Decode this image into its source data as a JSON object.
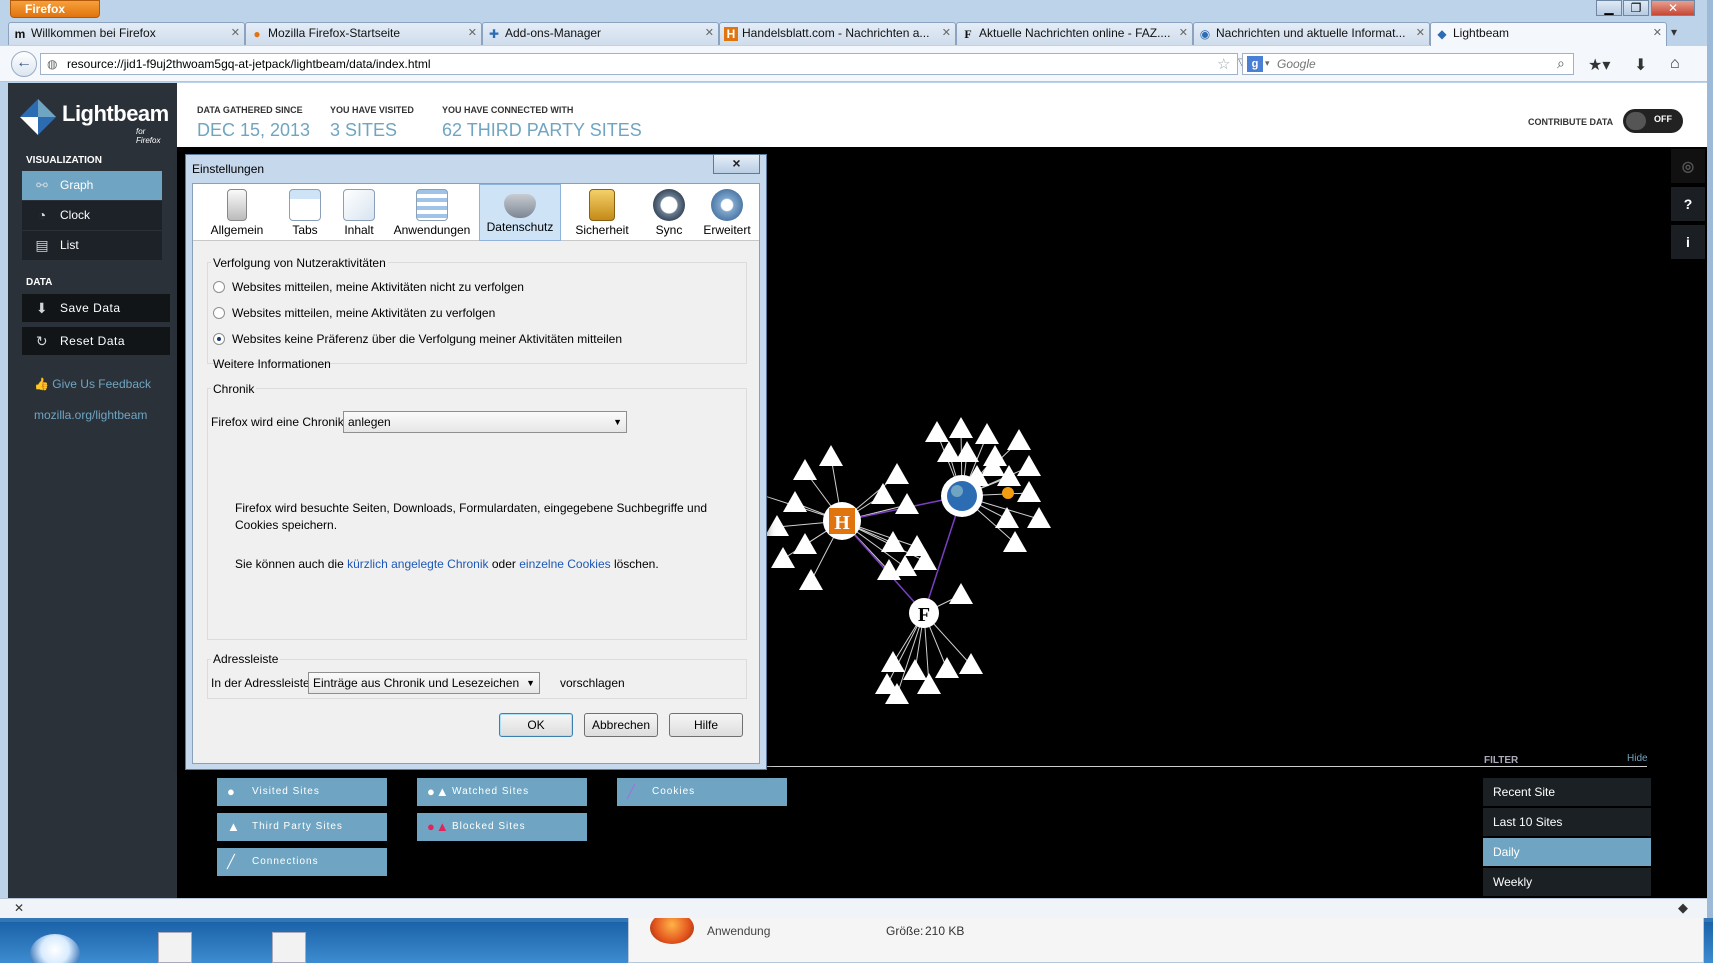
{
  "colors": {
    "accent": "#6fa5c2",
    "sidebar": "#2a3139",
    "firefox_orange": "#e0740f"
  },
  "firefox": {
    "menu_button": "Firefox",
    "tabs": [
      {
        "icon": "m",
        "label": "Willkommen bei Firefox"
      },
      {
        "icon": "ff",
        "label": "Mozilla Firefox-Startseite"
      },
      {
        "icon": "puzzle",
        "label": "Add-ons-Manager"
      },
      {
        "icon": "H",
        "label": "Handelsblatt.com - Nachrichten a..."
      },
      {
        "icon": "F",
        "label": "Aktuelle Nachrichten online - FAZ...."
      },
      {
        "icon": "e",
        "label": "Nachrichten und aktuelle Informat..."
      },
      {
        "icon": "lb",
        "label": "Lightbeam"
      }
    ],
    "url": "resource://jid1-f9uj2thwoam5gq-at-jetpack/lightbeam/data/index.html",
    "search_placeholder": "Google",
    "search_engine_letter": "g"
  },
  "lightbeam": {
    "logo_text": "Lightbeam",
    "logo_sub": "for Firefox",
    "visualization_header": "VISUALIZATION",
    "nav": [
      {
        "label": "Graph",
        "icon": "graph-icon"
      },
      {
        "label": "Clock",
        "icon": "clock-icon"
      },
      {
        "label": "List",
        "icon": "list-icon"
      }
    ],
    "data_header": "DATA",
    "save_data": "Save Data",
    "reset_data": "Reset Data",
    "feedback": "Give Us Feedback",
    "site_link": "mozilla.org/lightbeam",
    "stats": [
      {
        "label": "DATA GATHERED SINCE",
        "value": "DEC 15, 2013"
      },
      {
        "label": "YOU HAVE VISITED",
        "value": "3 SITES"
      },
      {
        "label": "YOU HAVE CONNECTED WITH",
        "value": "62 THIRD PARTY SITES"
      }
    ],
    "contribute_label": "CONTRIBUTE DATA",
    "contribute_state": "OFF",
    "filter_label": "FILTER",
    "filter_hide": "Hide",
    "filters": [
      "Recent Site",
      "Last 10 Sites",
      "Daily",
      "Weekly"
    ],
    "filter_selected": "Daily",
    "legend": {
      "visited": "Visited Sites",
      "watched": "Watched Sites",
      "cookies": "Cookies",
      "third_party": "Third Party Sites",
      "blocked": "Blocked Sites",
      "connections": "Connections"
    },
    "right_tools": [
      "?",
      "i"
    ]
  },
  "dialog": {
    "title": "Einstellungen",
    "close": "×",
    "panes": [
      "Allgemein",
      "Tabs",
      "Inhalt",
      "Anwendungen",
      "Datenschutz",
      "Sicherheit",
      "Sync",
      "Erweitert"
    ],
    "selected_pane": "Datenschutz",
    "tracking": {
      "caption": "Verfolgung von Nutzeraktivitäten",
      "options": [
        "Websites mitteilen, meine Aktivitäten nicht zu verfolgen",
        "Websites mitteilen, meine Aktivitäten zu verfolgen",
        "Websites keine Präferenz über die Verfolgung meiner Aktivitäten mitteilen"
      ],
      "selected_index": 2,
      "more_info": "Weitere Informationen"
    },
    "history": {
      "caption": "Chronik",
      "label": "Firefox wird eine Chronik:",
      "value": "anlegen",
      "desc1": "Firefox wird besuchte Seiten, Downloads, Formulardaten, eingegebene Suchbegriffe und Cookies speichern.",
      "desc2_prefix": "Sie können auch die",
      "desc2_link1": "kürzlich angelegte Chronik",
      "desc2_mid": "oder",
      "desc2_link2": "einzelne Cookies",
      "desc2_suffix": "löschen."
    },
    "locationbar": {
      "caption": "Adressleiste",
      "label": "In der Adressleiste",
      "value": "Einträge aus Chronik und Lesezeichen",
      "suffix": "vorschlagen"
    },
    "buttons": {
      "ok": "OK",
      "cancel": "Abbrechen",
      "help": "Hilfe"
    }
  },
  "download": {
    "type": "Anwendung",
    "size_label": "Größe:",
    "size": "210 KB"
  }
}
